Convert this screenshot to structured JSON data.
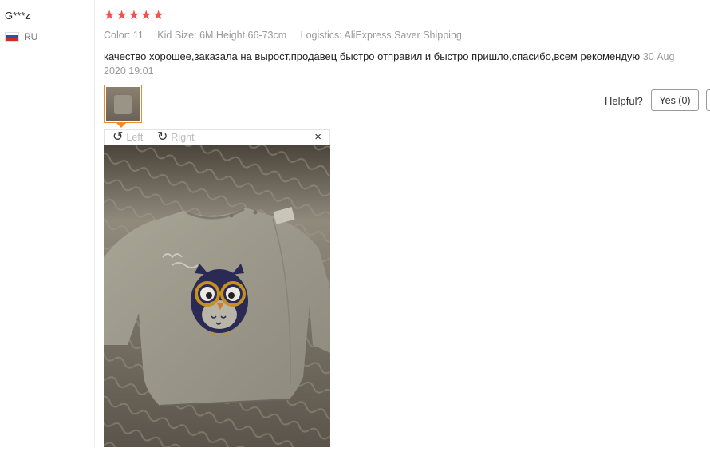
{
  "reviewer": {
    "name": "G***z",
    "country": "RU",
    "flag_colors": [
      "#ffffff",
      "#1c57a8",
      "#d52b1e"
    ]
  },
  "rating": {
    "value": 5,
    "max": 5,
    "stars": "★★★★★",
    "color": "#f0524f"
  },
  "meta": {
    "color": "Color: 11",
    "kid_size": "Kid Size: 6M Height 66-73cm",
    "logistics": "Logistics: AliExpress Saver Shipping"
  },
  "review": {
    "text": "качество хорошее,заказала на вырост,продавец быстро отправил и быстро пришло,спасибо,всем рекомендую",
    "date": "30 Aug 2020 19:01"
  },
  "image_viewer": {
    "rotate_left_label": "Left",
    "rotate_right_label": "Right",
    "rotate_left_icon": "rotate-left-icon",
    "rotate_right_icon": "rotate-right-icon",
    "close_symbol": "×",
    "accent_color": "#f08a24"
  },
  "helpful": {
    "label": "Helpful?",
    "yes_label": "Yes (0)",
    "no_label": ""
  }
}
